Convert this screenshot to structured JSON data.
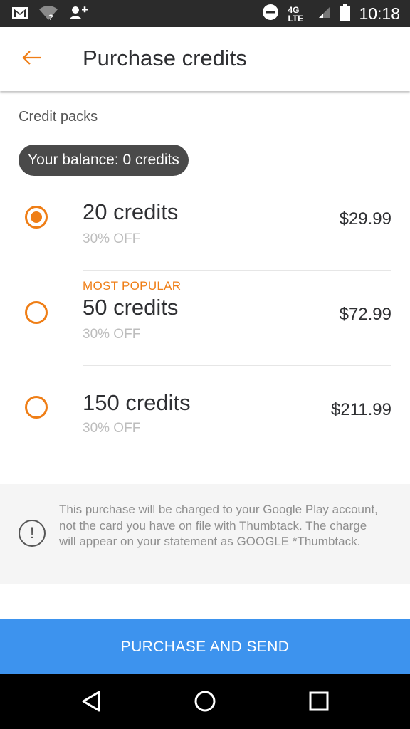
{
  "status_bar": {
    "time": "10:18",
    "network": "4G LTE",
    "icons": [
      "gmail-icon",
      "wifi-unknown-icon",
      "add-person-icon",
      "do-not-disturb-icon",
      "signal-icon",
      "battery-icon"
    ]
  },
  "header": {
    "title": "Purchase credits",
    "back_icon": "arrow-left-icon"
  },
  "section": {
    "label": "Credit packs",
    "balance": "Your balance: 0 credits"
  },
  "packs": [
    {
      "name": "20 credits",
      "discount": "30% OFF",
      "price": "$29.99",
      "badge": "",
      "selected": true
    },
    {
      "name": "50 credits",
      "discount": "30% OFF",
      "price": "$72.99",
      "badge": "MOST POPULAR",
      "selected": false
    },
    {
      "name": "150 credits",
      "discount": "30% OFF",
      "price": "$211.99",
      "badge": "",
      "selected": false
    }
  ],
  "notice": {
    "icon": "exclamation-circle-icon",
    "text": "This purchase will be charged to your Google Play account, not the card you have on file with Thumbtack. The charge will appear on your statement as GOOGLE *Thumbtack."
  },
  "cta": {
    "label": "PURCHASE AND SEND"
  },
  "colors": {
    "accent": "#ef7e16",
    "primary_button": "#3d93ee",
    "balance_pill": "#4a4a4a",
    "status_bar": "#2b2b2b"
  },
  "nav_bar": {
    "icons": [
      "back-triangle-icon",
      "home-circle-icon",
      "recents-square-icon"
    ]
  }
}
